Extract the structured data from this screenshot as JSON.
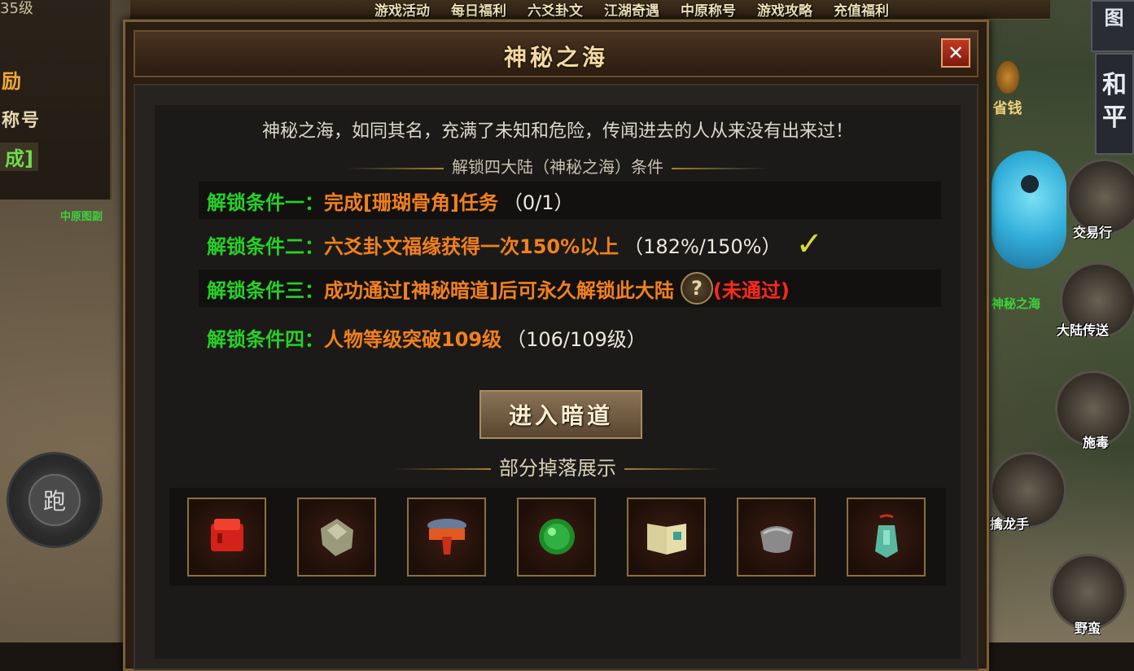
{
  "top_menu": [
    "游戏活动",
    "每日福利",
    "六爻卦文",
    "江湖奇遇",
    "中原称号",
    "游戏攻略",
    "充值福利"
  ],
  "left_panel": {
    "level_text": "35级",
    "reward_text": "励",
    "title_text": "称号",
    "done_text": "成]",
    "map_label": "中原图副",
    "run_button": "跑"
  },
  "right_panel": {
    "top_icon_text": "图",
    "peace_mode_text": "和平",
    "money_label": "省钱",
    "trade_label": "交易行",
    "mystic_sea_label": "神秘之海",
    "continent_teleport_label": "大陆传送",
    "skill_1": "施毒",
    "skill_2": "擒龙手",
    "skill_3": "野蛮"
  },
  "dialog": {
    "title": "神秘之海",
    "close_label": "✕",
    "description": "神秘之海，如同其名，充满了未知和危险，传闻进去的人从来没有出来过！",
    "conditions_heading": "解锁四大陆（神秘之海）条件",
    "conditions": [
      {
        "label": "解锁条件一：",
        "text": "完成[珊瑚骨角]任务",
        "progress": "（0/1）",
        "status": "pending"
      },
      {
        "label": "解锁条件二：",
        "text": "六爻卦文福缘获得一次150%以上",
        "progress": "（182%/150%）",
        "status": "done"
      },
      {
        "label": "解锁条件三：",
        "text": "成功通过[神秘暗道]后可永久解锁此大陆",
        "progress": "",
        "status": "failed",
        "fail_text": "(未通过)"
      },
      {
        "label": "解锁条件四：",
        "text": "人物等级突破109级",
        "progress": "（106/109级）",
        "status": "pending"
      }
    ],
    "enter_button": "进入暗道",
    "drops_heading": "部分掉落展示",
    "drop_items": [
      "red-gem-icon",
      "ore-stone-icon",
      "belt-icon",
      "jade-ring-icon",
      "skill-book-icon",
      "helmet-icon",
      "pendant-icon"
    ]
  },
  "colors": {
    "condition_label": "#27d027",
    "condition_text": "#f2801e",
    "fail_text": "#ff2a1a",
    "check_mark": "#d8dc35"
  }
}
